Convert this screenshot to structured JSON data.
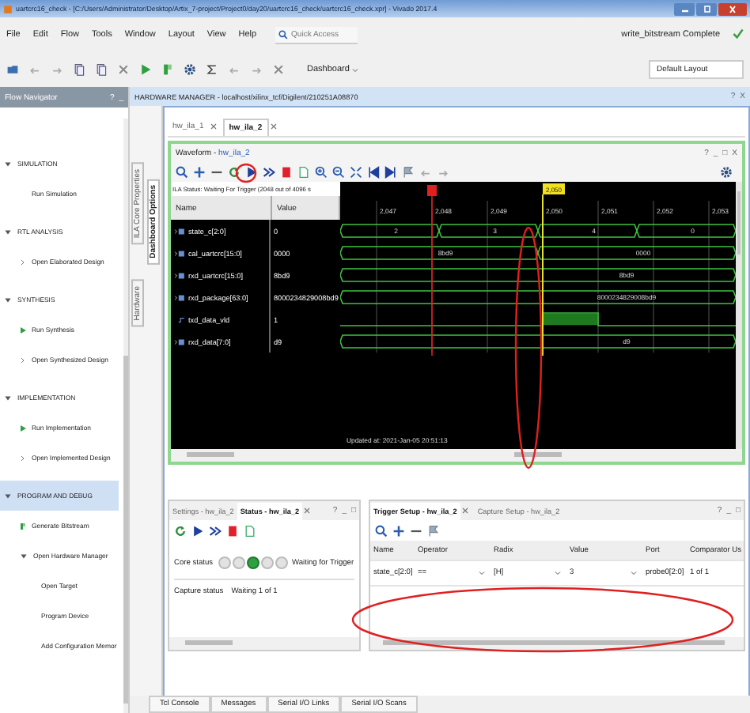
{
  "window": {
    "title": "uartcrc16_check - [C:/Users/Administrator/Desktop/Artix_7-project/Project0/day20/uartcrc16_check/uartcrc16_check.xpr] - Vivado 2017.4"
  },
  "menu": [
    "File",
    "Edit",
    "Flow",
    "Tools",
    "Window",
    "Layout",
    "View",
    "Help"
  ],
  "quick_access": {
    "placeholder": "Quick Access"
  },
  "run_status": {
    "text": "write_bitstream Complete",
    "ok": true
  },
  "toolbar": {
    "dashboard": "Dashboard",
    "layout": "Default Layout"
  },
  "flow_navigator": {
    "title": "Flow Navigator",
    "controls": [
      "?",
      "_"
    ],
    "sections": [
      {
        "label": "SIMULATION",
        "expanded": true,
        "selected": false,
        "items": [
          {
            "label": "Run Simulation",
            "kind": "plain"
          }
        ]
      },
      {
        "label": "RTL ANALYSIS",
        "expanded": true,
        "selected": false,
        "items": [
          {
            "label": "Open Elaborated Design",
            "kind": "open"
          }
        ]
      },
      {
        "label": "SYNTHESIS",
        "expanded": true,
        "selected": false,
        "items": [
          {
            "label": "Run Synthesis",
            "kind": "run"
          },
          {
            "label": "Open Synthesized Design",
            "kind": "open"
          }
        ]
      },
      {
        "label": "IMPLEMENTATION",
        "expanded": true,
        "selected": false,
        "items": [
          {
            "label": "Run Implementation",
            "kind": "run"
          },
          {
            "label": "Open Implemented Design",
            "kind": "open"
          }
        ]
      },
      {
        "label": "PROGRAM AND DEBUG",
        "expanded": true,
        "selected": true,
        "items": [
          {
            "label": "Generate Bitstream",
            "kind": "bitstream"
          },
          {
            "label": "Open Hardware Manager",
            "kind": "group",
            "expanded": true,
            "children": [
              {
                "label": "Open Target",
                "kind": "plain"
              },
              {
                "label": "Program Device",
                "kind": "plain"
              },
              {
                "label": "Add Configuration Memor",
                "kind": "plain"
              }
            ]
          }
        ]
      }
    ]
  },
  "hardware_manager": {
    "title": "HARDWARE MANAGER - localhost/xilinx_tcf/Digilent/210251A08870",
    "controls": [
      "?",
      "X"
    ]
  },
  "side_tabs": [
    {
      "label": "ILA Core Properties",
      "selected": false
    },
    {
      "label": "Hardware",
      "selected": false
    },
    {
      "label": "Dashboard Options",
      "selected": true
    }
  ],
  "ila_tabs": [
    {
      "label": "hw_ila_1",
      "selected": false
    },
    {
      "label": "hw_ila_2",
      "selected": true
    }
  ],
  "waveform": {
    "title": "Waveform - ",
    "link": "hw_ila_2",
    "controls": [
      "?",
      "_",
      "□",
      "X"
    ],
    "ila_status": "ILA Status: Waiting For Trigger (2048 out of 4096 s",
    "columns": [
      "Name",
      "Value"
    ],
    "signals": [
      {
        "name": "state_c[2:0]",
        "value": "0",
        "kind": "bus",
        "segments": [
          "2",
          "3",
          "4",
          "0"
        ]
      },
      {
        "name": "cal_uartcrc[15:0]",
        "value": "0000",
        "kind": "bus",
        "segments": [
          "8bd9",
          "0000"
        ]
      },
      {
        "name": "rxd_uartcrc[15:0]",
        "value": "8bd9",
        "kind": "bus",
        "segments": [
          "8bd9"
        ]
      },
      {
        "name": "rxd_package[63:0]",
        "value": "8000234829008bd9",
        "kind": "bus",
        "segments": [
          "8000234829008bd9"
        ]
      },
      {
        "name": "txd_data_vld",
        "value": "1",
        "kind": "bit"
      },
      {
        "name": "rxd_data[7:0]",
        "value": "d9",
        "kind": "bus",
        "segments": [
          "d9"
        ]
      }
    ],
    "time_labels": [
      "2,047",
      "2,048",
      "2,049",
      "2,050",
      "2,051",
      "2,052",
      "2,053"
    ],
    "cursor_label": "2,050",
    "updated": "Updated at: 2021-Jan-05 20:51:13"
  },
  "status_panel": {
    "tabs": [
      {
        "label": "Settings - hw_ila_2",
        "selected": false
      },
      {
        "label": "Status - hw_ila_2",
        "selected": true
      }
    ],
    "controls": [
      "?",
      "_",
      "□"
    ],
    "core_status_label": "Core status",
    "lights": [
      {
        "on": false
      },
      {
        "on": false
      },
      {
        "on": true
      },
      {
        "on": false
      },
      {
        "on": false
      }
    ],
    "core_status": "Waiting for Trigger",
    "capture_status_label": "Capture status",
    "capture_status": "Waiting 1 of 1"
  },
  "trigger_panel": {
    "tabs": [
      {
        "label": "Trigger Setup - hw_ila_2",
        "selected": true
      },
      {
        "label": "Capture Setup - hw_ila_2",
        "selected": false
      }
    ],
    "controls": [
      "?",
      "_",
      "□"
    ],
    "columns": [
      "Name",
      "Operator",
      "Radix",
      "Value",
      "Port",
      "Comparator Us"
    ],
    "rows": [
      {
        "name": "state_c[2:0]",
        "operator": "==",
        "radix": "[H]",
        "value": "3",
        "port": "probe0[2:0]",
        "comparator": "1 of 1"
      }
    ]
  },
  "bottom_tabs": [
    "Tcl Console",
    "Messages",
    "Serial I/O Links",
    "Serial I/O Scans"
  ]
}
